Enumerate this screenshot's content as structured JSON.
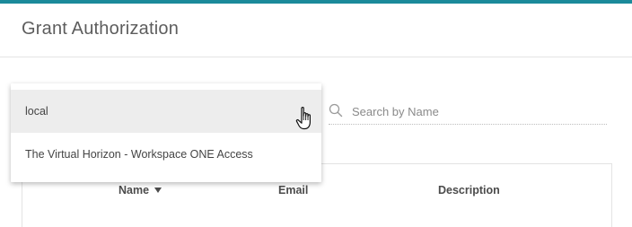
{
  "dialog": {
    "title": "Grant Authorization"
  },
  "domain_dropdown": {
    "options": [
      {
        "label": "local",
        "highlighted": true
      },
      {
        "label": "The Virtual Horizon - Workspace ONE Access",
        "highlighted": false
      }
    ]
  },
  "search": {
    "placeholder": "Search by Name",
    "value": "",
    "icon": "search-icon"
  },
  "table": {
    "columns": [
      {
        "label": "Name",
        "sort": "descending"
      },
      {
        "label": "Email"
      },
      {
        "label": "Description"
      }
    ]
  },
  "colors": {
    "accent": "#1b8a9a",
    "highlight_row": "#ededed"
  }
}
